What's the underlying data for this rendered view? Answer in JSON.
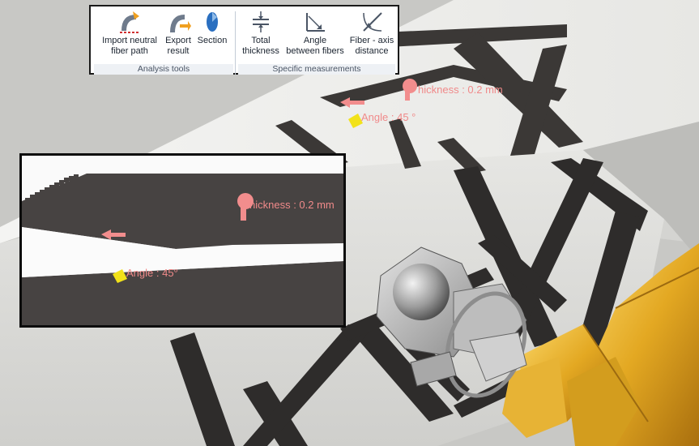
{
  "ribbon": {
    "buttons": [
      {
        "id": "import-neutral",
        "label_line1": "Import neutral",
        "label_line2": "fiber path",
        "icon": "import-fiber-path-icon"
      },
      {
        "id": "export-result",
        "label_line1": "Export",
        "label_line2": "result",
        "icon": "export-result-icon"
      },
      {
        "id": "section",
        "label_line1": "Section",
        "label_line2": "",
        "icon": "section-icon"
      },
      {
        "id": "total-thickness",
        "label_line1": "Total",
        "label_line2": "thickness",
        "icon": "total-thickness-icon"
      },
      {
        "id": "angle-between-fibers",
        "label_line1": "Angle",
        "label_line2": "between fibers",
        "icon": "angle-between-fibers-icon"
      },
      {
        "id": "fiber-axis-distance",
        "label_line1": "Fiber - axis",
        "label_line2": "distance",
        "icon": "fiber-axis-distance-icon"
      }
    ],
    "groups": {
      "analysis_tools": "Analysis tools",
      "specific_measurements": "Specific measurements"
    }
  },
  "scene": {
    "thickness_label": "hickness : 0.2 mm",
    "angle_label": "Angle : 45 °"
  },
  "inset": {
    "thickness_label": "hickness : 0.2 mm",
    "angle_label": "Angle : 45°"
  },
  "colors": {
    "annotation_text": "#f08a8a",
    "fiber_tape": "#3d3a38",
    "robot_arm": "#e8b12c",
    "marker_yellow": "#f2e21a",
    "marker_pink": "#f28d8d"
  }
}
